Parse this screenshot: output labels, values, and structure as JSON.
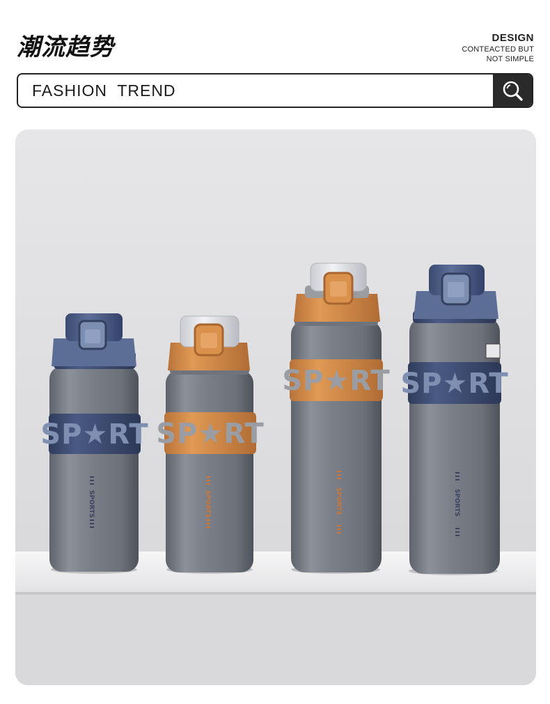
{
  "header": {
    "title": "潮流趋势",
    "design_label": "DESIGN",
    "tagline_line1": "CONTEACTED BUT",
    "tagline_line2": "NOT SIMPLE"
  },
  "search": {
    "text": "FASHION  TREND",
    "icon": "search-icon"
  },
  "photo": {
    "bottles": [
      {
        "band_text": "SP★RT",
        "vertical_text": "SPORTS",
        "accent": "#3f4f75"
      },
      {
        "band_text": "SP★RT",
        "vertical_text": "SPORTS",
        "accent": "#d48a45"
      },
      {
        "band_text": "SP★RT",
        "vertical_text": "SPORTS",
        "accent": "#d48a45"
      },
      {
        "band_text": "SP★RT",
        "vertical_text": "SPORTS",
        "accent": "#3f4f75"
      }
    ]
  },
  "colors": {
    "wall": "#dcdcde",
    "shelf": "#eeeeef",
    "steel": "#7c8088",
    "navy": "#3f4f75",
    "orange": "#d48a45",
    "lid_gray": "#9a9ca0"
  }
}
